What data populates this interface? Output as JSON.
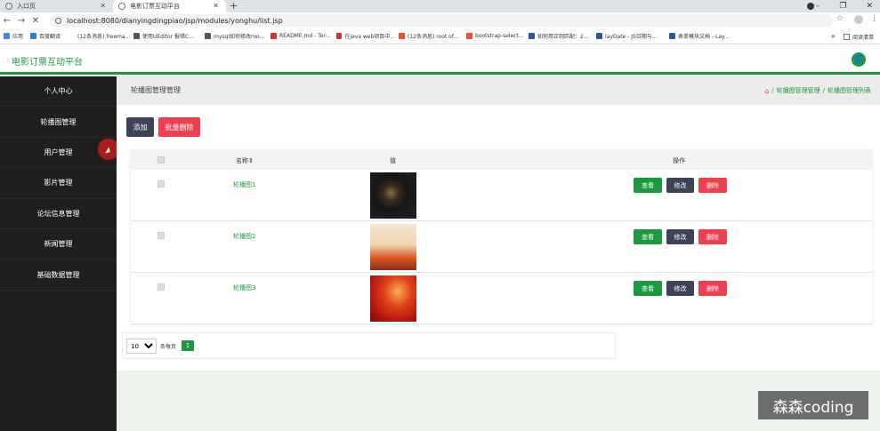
{
  "browser": {
    "tabs": [
      {
        "label": "入口页"
      },
      {
        "label": "电影订票互动平台"
      }
    ],
    "new_tab": "+",
    "url": "localhost:8080/dianyingdingpiao/jsp/modules/yonghu/list.jsp",
    "bookmarks": [
      {
        "label": "应用",
        "color": "#4285f4"
      },
      {
        "label": "百度翻译",
        "color": "#2b7fe0"
      },
      {
        "label": "(12条消息) freema...",
        "color": "#e8542f"
      },
      {
        "label": "使用UEditor 报错C...",
        "color": "#555"
      },
      {
        "label": "mysql如何修改roo...",
        "color": "#555"
      },
      {
        "label": "README.md - Ter...",
        "color": "#d13438"
      },
      {
        "label": "在java web项目中...",
        "color": "#d13438"
      },
      {
        "label": "(12条消息) root of...",
        "color": "#e8542f"
      },
      {
        "label": "bootstrap-select...",
        "color": "#e8542f"
      },
      {
        "label": "如何用正则匹配：2...",
        "color": "#2b5797"
      },
      {
        "label": "layDate - JS日期与...",
        "color": "#2b5797"
      },
      {
        "label": "表单模块文档 - Lay...",
        "color": "#2b5797"
      }
    ],
    "bookmarks_more": "»",
    "reading_list": "阅读清单"
  },
  "app": {
    "title": "电影订票互动平台"
  },
  "sidebar": {
    "items": [
      {
        "label": "个人中心"
      },
      {
        "label": "轮播图管理"
      },
      {
        "label": "用户管理"
      },
      {
        "label": "影片管理"
      },
      {
        "label": "论坛信息管理"
      },
      {
        "label": "新闻管理"
      },
      {
        "label": "基础数据管理"
      }
    ]
  },
  "main": {
    "heading": "轮播图管理管理",
    "breadcrumb": {
      "sep": "/",
      "level1": "轮播图管理管理",
      "level2": "轮播图管理列表"
    },
    "toolbar": {
      "add_label": "添加",
      "bulk_delete_label": "批量删除"
    },
    "table": {
      "headers": {
        "name": "名称⇕",
        "value": "值",
        "actions": "操作"
      },
      "rows": [
        {
          "name": "轮播图1"
        },
        {
          "name": "轮播图2"
        },
        {
          "name": "轮播图3"
        }
      ],
      "action_labels": {
        "view": "查看",
        "edit": "修改",
        "delete": "删除"
      }
    },
    "pager": {
      "page_size": "10",
      "per_page_label": "条每页",
      "current_page": "1"
    }
  },
  "watermark": "森森coding",
  "colors": {
    "accent": "#1a9a3e",
    "danger": "#ef4050",
    "dark": "#3d4459",
    "sidebar": "#1f1f1f"
  }
}
